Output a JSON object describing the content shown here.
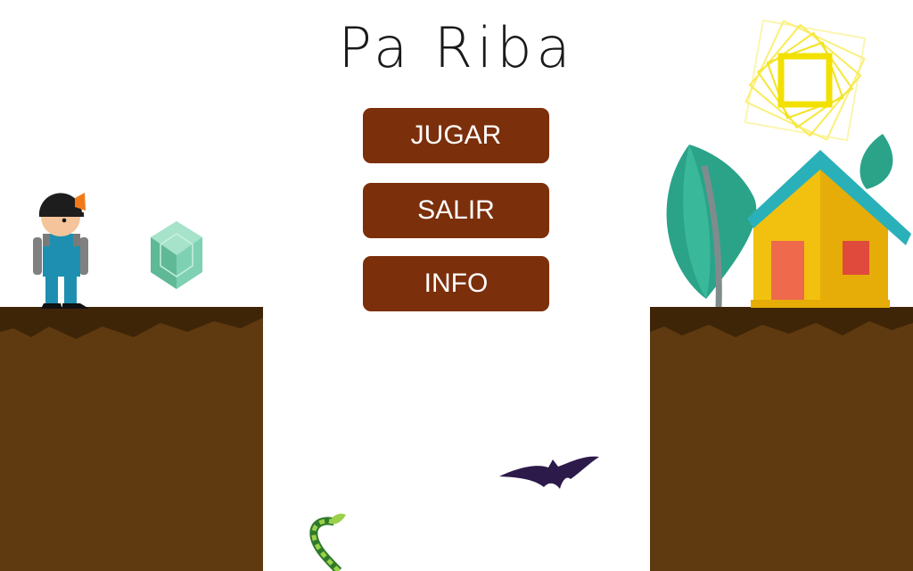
{
  "title": "Pa Riba",
  "menu": {
    "play_label": "JUGAR",
    "exit_label": "SALIR",
    "info_label": "INFO"
  },
  "colors": {
    "button": "#7b2f0b",
    "ground": "#5f3a10",
    "sun": "#f2e000",
    "leaf": "#2aa389",
    "house_wall": "#f2c110",
    "roof": "#2ab0b8",
    "bat": "#2c1a4a",
    "gem": "#7fd1b3"
  },
  "icons": [
    "miner-character",
    "gem-icon",
    "sun-icon",
    "tree-leaf",
    "house-icon",
    "bat-enemy",
    "vine-sprout"
  ]
}
